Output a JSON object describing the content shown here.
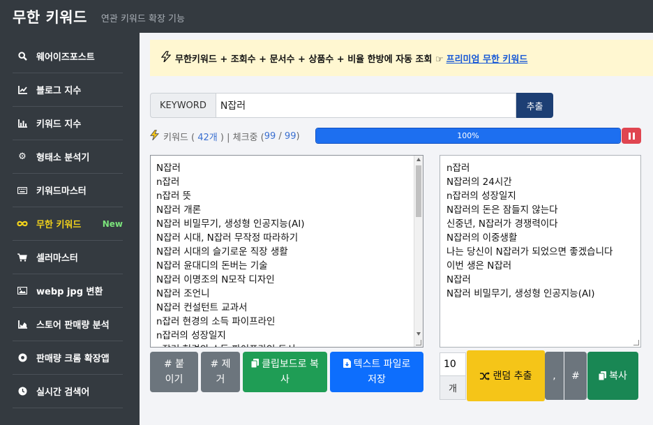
{
  "header": {
    "brand": "무한 키워드",
    "subtitle": "연관 키워드 확장 기능"
  },
  "sidebar": {
    "items": [
      {
        "label": "웨어이즈포스트",
        "icon": "search-icon"
      },
      {
        "label": "블로그 지수",
        "icon": "line-chart-icon"
      },
      {
        "label": "키워드 지수",
        "icon": "bar-chart-icon"
      },
      {
        "label": "형태소 분석기",
        "icon": "gear-icon"
      },
      {
        "label": "키워드마스터",
        "icon": "keyboard-icon"
      },
      {
        "label": "무한 키워드",
        "icon": "infinity-icon",
        "badge": "New"
      },
      {
        "label": "셀러마스터",
        "icon": "cart-icon"
      },
      {
        "label": "webp jpg 변환",
        "icon": "image-icon"
      },
      {
        "label": "스토어 판매량 분석",
        "icon": "area-chart-icon"
      },
      {
        "label": "판매량 크롬 확장앱",
        "icon": "chrome-icon"
      },
      {
        "label": "실시간 검색어",
        "icon": "clock-icon"
      }
    ]
  },
  "banner": {
    "text": "무한키워드 + 조회수 + 문서수 + 상품수 + 비율 한방에 자동 조회 ☞",
    "link": "프리미엄 무한 키워드"
  },
  "search": {
    "prefix": "KEYWORD",
    "value": "N잡러",
    "button": "추출"
  },
  "status": {
    "label": "키워드 (",
    "count": "42개",
    "mid": ") | 체크중 (",
    "checked": "99",
    "sep": "/",
    "total": "99",
    "end": ")",
    "progress_percent": 100,
    "progress_text": "100%",
    "accent": "#1d6ff0"
  },
  "left_list": [
    "N잡러",
    "n잡러",
    "n잡러 뜻",
    "N잡러 개론",
    "N잡러 비밀무기, 생성형 인공지능(AI)",
    "N잡러 시대, N잡러 무작정 따라하기",
    "N잡러 시대의 슬기로운 직장 생활",
    "N잡러 윤대디의 돈버는 기술",
    "N잡러 이명조의 N모작 디자인",
    "N잡러 조언니",
    "N잡러 컨설턴트 교과서",
    "n잡러 현경의 소득 파이프라인",
    "n잡러의 성장일지",
    "n잡러 현경의 소득 파이프라인 도서"
  ],
  "right_list": [
    "n잡러",
    "N잡러의 24시간",
    "n잡러의 성장일지",
    "N잡러의 돈은 잠들지 않는다",
    "신중년, N잡러가 경쟁력이다",
    "N잡러의 이중생활",
    "나는 당신이 N잡러가 되었으면 좋겠습니다",
    "이번 생은 N잡러",
    "N잡러",
    "N잡러 비밀무기, 생성형 인공지능(AI)"
  ],
  "buttons": {
    "add_hash": "# 붙이기",
    "remove_hash": "# 제거",
    "clipboard": "클립보드로 복사",
    "save_text": "텍스트 파일로 저장",
    "count_value": "10",
    "count_suffix": "개",
    "random": "랜덤 추출",
    "comma": ",",
    "hash": "#",
    "copy": "복사"
  }
}
